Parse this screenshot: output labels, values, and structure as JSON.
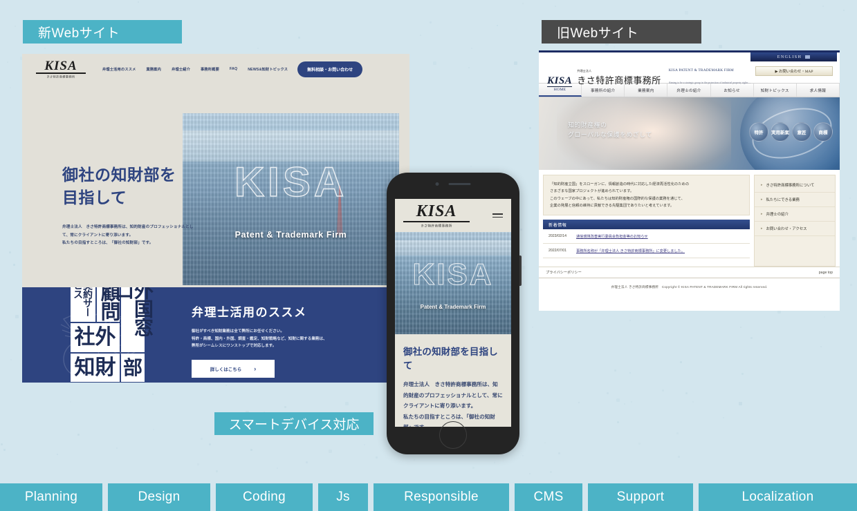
{
  "theme": {
    "background": "#d3e6ee",
    "accent_teal": "#4cb3c6",
    "accent_navy": "#2e4480",
    "label_dark": "#4a4a4a"
  },
  "labels": {
    "new_site": "新Webサイト",
    "old_site": "旧Webサイト",
    "smart_device": "スマートデバイス対応"
  },
  "new_site": {
    "logo": {
      "mark": "KISA",
      "sub": "きさ特許商標事務所"
    },
    "nav": [
      "弁理士活用のススメ",
      "業務案内",
      "弁理士紹介",
      "事務所概要",
      "FAQ",
      "NEWS&知財トピックス"
    ],
    "cta": "無料相談・お問い合わせ",
    "hero": {
      "overlay_title": "KISA",
      "overlay_tagline": "Patent & Trademark Firm",
      "title": "御社の知財部を\n目指して",
      "body": "弁理士法人　きさ特許商標事務所は、知的財産のプロフェッショナルとして、常にクライアントに寄り添います。\n私たちの目指すところは、「御社の知財部」です。"
    },
    "band": {
      "collage": {
        "keiyaku": "契約サービス",
        "komon": "顧問",
        "gaikoku": "外国窓口",
        "shagai": "社外",
        "chizai": "知財",
        "bu": "部"
      },
      "title": "弁理士活用のススメ",
      "body": "御社がすべき知財業務は全て弊所にお任せください。\n特許・商標、国内・外国、調査・鑑定、知財戦略など、知財に関する業務は、\n弊所がシームレスにワンストップで対応します。",
      "button": "詳しくはこちら",
      "button_chevron": "›"
    }
  },
  "phone": {
    "logo": {
      "mark": "KISA",
      "sub": "きさ特許商標事務所"
    },
    "menu_icon": "hamburger-icon",
    "hero": {
      "overlay_title": "KISA",
      "overlay_tagline": "Patent & Trademark Firm"
    },
    "title": "御社の知財部を目指して",
    "body": "弁理士法人　きさ特許商標事務所は、知的財産のプロフェッショナルとして、常にクライアントに寄り添います。\n私たちの目指すところは、「御社の知財部」です。"
  },
  "old_site": {
    "english_link": "ENGLISH",
    "contact_link": "▶ お問い合わせ・MAP",
    "logo": {
      "mark": "KISA",
      "tiny": "弁理士法人",
      "jp": "きさ特許商標事務所",
      "en1": "KISA PATENT & TRADEMARK FIRM",
      "en2": "Aiming to be a strategic group in the protection of industrial property rights ..."
    },
    "nav": [
      "HOME",
      "事務所の紹介",
      "業務案内",
      "弁理士の紹介",
      "お知らせ",
      "知財トピックス",
      "求人情報"
    ],
    "banner": {
      "line1": "知的財産権の",
      "line2": "グローバルな保護をめざして",
      "circles": [
        "特許",
        "実用新案",
        "意匠",
        "商標"
      ]
    },
    "intro": "「知的財産立国」をスローガンに、情報創造の時代に対応した経済再活性化のための\nさまざまな国家プロジェクトが進められています。\nこのウェーブの中にあって、私たちは知的財産権の国際的な保護の業務を通じて、\n企業の発展と信頼の維持に貢献できる先駆集団でありたいと考えています。",
    "news_heading": "新着情報",
    "news": [
      {
        "date": "2023/02/14",
        "title": "通信環境改善実行委員会負担金等のお知らせ"
      },
      {
        "date": "2022/07/01",
        "title": "事務所名称が「弁理士法人 きさ特許商標事務所」に変更しました。"
      }
    ],
    "sidebar": [
      "きさ特許商標事務所について",
      "私たちにできる業務",
      "弁理士の紹介",
      "お問い合わせ・アクセス"
    ],
    "footer": {
      "privacy": "プライバシーポリシー",
      "page_top": "page top",
      "copyright": "弁理士法人 きさ特許商標事務所　Copyright © KISA PATENT & TRADEMARK FIRM All rights reserved."
    }
  },
  "tags": [
    "Planning",
    "Design",
    "Coding",
    "Js",
    "Responsible",
    "CMS",
    "Support",
    "Localization"
  ]
}
